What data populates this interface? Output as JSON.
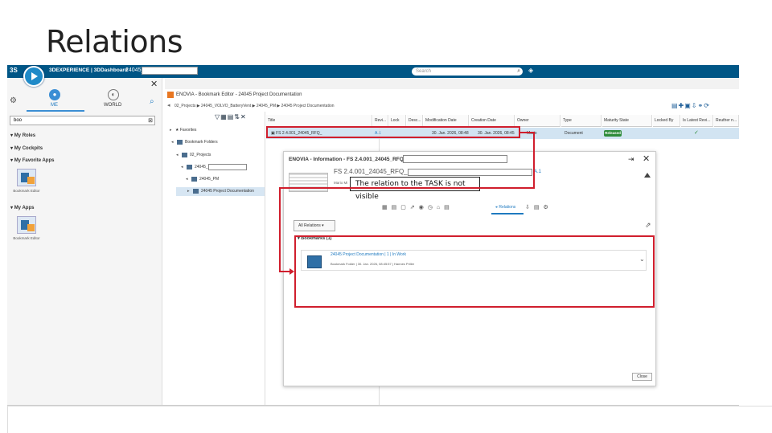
{
  "slide": {
    "title": "Relations"
  },
  "topbar": {
    "logo": "3S",
    "compass_label": "V.R",
    "brand": "3DEXPERIENCE | 3DDashboard",
    "tab_name": "24045_",
    "search_placeholder": "Search"
  },
  "left_panel": {
    "me_label": "ME",
    "world_label": "WORLD",
    "search_value": "boo",
    "sections": [
      "My Roles",
      "My Cockpits",
      "My Favorite Apps",
      "My Apps"
    ],
    "apps": [
      "Bookmark Editor",
      "Bookmark Editor"
    ]
  },
  "enovia": {
    "header": "ENOVIA - Bookmark Editor - 24045 Project Documentation",
    "breadcrumb": "02_Projects ▶ 24045_VOLVO_BatteryVent ▶ 24045_PM ▶ 24045 Project Documentation",
    "tree": [
      {
        "label": "Favorites",
        "tri": "▸"
      },
      {
        "label": "Bookmark Folders",
        "tri": "◂"
      },
      {
        "label": "02_Projects",
        "tri": "◂"
      },
      {
        "label": "24045_",
        "tri": "◂"
      },
      {
        "label": "24045_PM",
        "tri": "◂"
      },
      {
        "label": "24045 Project Documentation",
        "tri": "▸"
      }
    ],
    "columns": [
      "Title",
      "Revi...",
      "Lock",
      "Desc...",
      "Modification Date",
      "Creation Date",
      "Owner",
      "Type",
      "Maturity State",
      "Locked By",
      "Is Latest Revi...",
      "Reuther n..."
    ],
    "row": {
      "title": "FS 2.4.001_24045_RFQ_",
      "revision": "A.1",
      "modified": "30. Jan. 2026, 08:48",
      "created": "30. Jan. 2026, 08:45",
      "owner": "Mario",
      "type": "Document",
      "maturity": "Released"
    }
  },
  "info": {
    "title": "ENOVIA - Information - FS 2.4.001_24045_RFQ_",
    "object_title": "FS 2.4.001_24045_RFQ_",
    "revision": "A.1",
    "owner_line": "Mario Mi",
    "callout": "The relation to the TASK is not visible",
    "tab_active": "Relations",
    "dropdown": "All Relations",
    "bookmarks_header": "Bookmarks (1)",
    "bookmark_title": "24045 Project Documentation | 1 | In Work",
    "bookmark_meta": "Bookmark Folder | 30. Jan. 2026, 08:45:57 | Hannes Priller",
    "close_label": "Close"
  },
  "colors": {
    "accent": "#005686",
    "highlight": "#d01e2d",
    "released": "#2e8b3a"
  }
}
